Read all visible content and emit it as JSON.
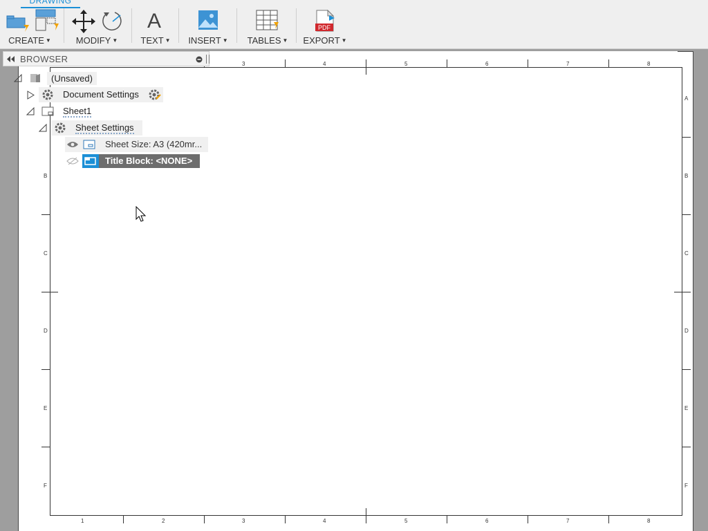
{
  "workspace_tab": "DRAWING",
  "toolbar": {
    "create_label": "CREATE",
    "modify_label": "MODIFY",
    "text_label": "TEXT",
    "insert_label": "INSERT",
    "tables_label": "TABLES",
    "export_label": "EXPORT",
    "text_glyph": "A",
    "pdf_badge": "PDF"
  },
  "browser": {
    "title": "BROWSER",
    "nodes": {
      "root": "(Unsaved)",
      "document_settings": "Document Settings",
      "sheet1": "Sheet1",
      "sheet_settings": "Sheet Settings",
      "sheet_size": "Sheet Size: A3 (420mr...",
      "title_block": "Title Block: <NONE>"
    }
  },
  "sheet": {
    "top_columns": [
      "3",
      "4",
      "5",
      "6",
      "7",
      "8"
    ],
    "bottom_columns": [
      "1",
      "2",
      "3",
      "4",
      "5",
      "6",
      "7",
      "8"
    ],
    "left_rows": [
      "B",
      "C",
      "D",
      "E",
      "F"
    ],
    "right_rows": [
      "A",
      "B",
      "C",
      "D",
      "E",
      "F"
    ]
  },
  "colors": {
    "accent": "#1b8fd6",
    "selection": "#6d6d6d",
    "icon_orange": "#f2a200"
  }
}
